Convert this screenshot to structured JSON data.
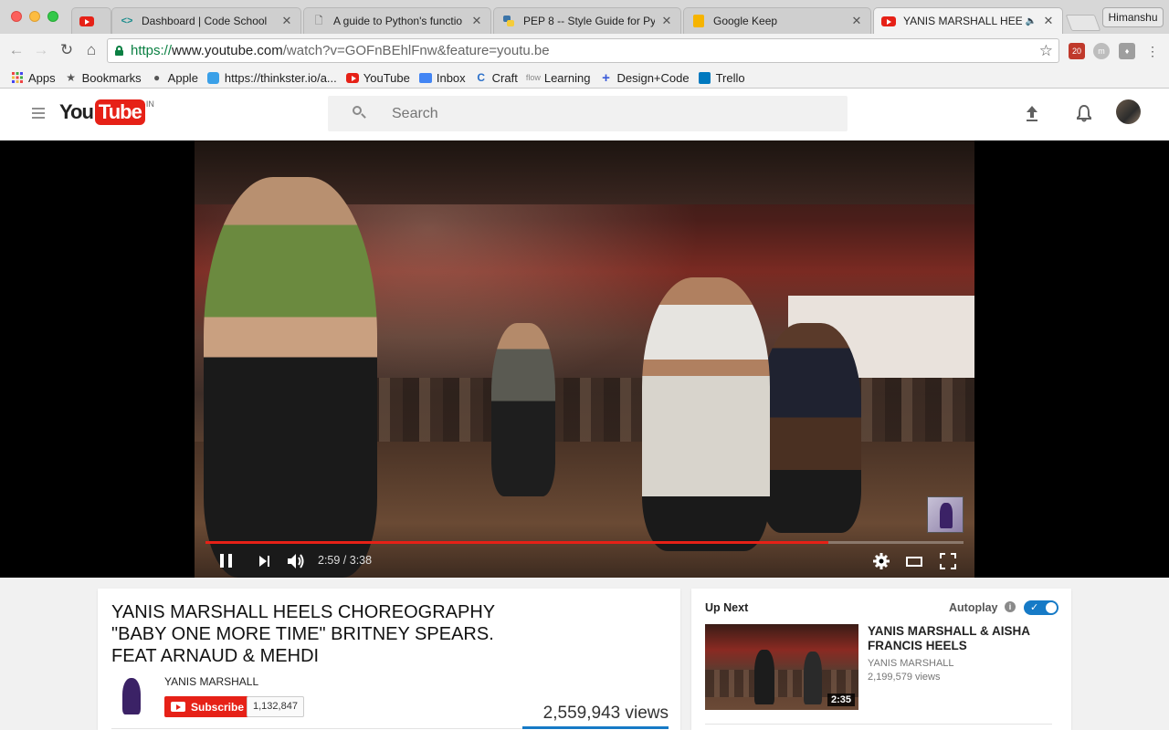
{
  "browser": {
    "tabs": [
      {
        "title": "",
        "favicon": "youtube-icon"
      },
      {
        "title": "Dashboard | Code School",
        "favicon": "code-school-icon"
      },
      {
        "title": "A guide to Python's functio",
        "favicon": "document-icon"
      },
      {
        "title": "PEP 8 -- Style Guide for Py",
        "favicon": "python-icon"
      },
      {
        "title": "Google Keep",
        "favicon": "keep-icon"
      },
      {
        "title": "YANIS MARSHALL HEEL",
        "favicon": "youtube-icon",
        "active": true,
        "audio": true
      }
    ],
    "profile_name": "Himanshu",
    "url": {
      "scheme": "https://",
      "host": "www.youtube.com",
      "path": "/watch?v=GOFnBEhlFnw&feature=youtu.be"
    },
    "extension_badge": "20",
    "bookmarks": [
      {
        "label": "Apps",
        "icon": "apps-grid-icon"
      },
      {
        "label": "Bookmarks",
        "icon": "star-icon"
      },
      {
        "label": "Apple",
        "icon": "apple-icon"
      },
      {
        "label": "https://thinkster.io/a...",
        "icon": "thinkster-icon"
      },
      {
        "label": "YouTube",
        "icon": "youtube-icon"
      },
      {
        "label": "Inbox",
        "icon": "inbox-icon"
      },
      {
        "label": "Craft",
        "icon": "craft-icon"
      },
      {
        "label": "Learning",
        "icon": "learning-icon"
      },
      {
        "label": "Design+Code",
        "icon": "plus-icon"
      },
      {
        "label": "Trello",
        "icon": "trello-icon"
      }
    ]
  },
  "youtube": {
    "logo_you": "You",
    "logo_tube": "Tube",
    "country": "IN",
    "search_placeholder": "Search",
    "accent": "#e62117"
  },
  "player": {
    "time_current": "2:59",
    "time_total": "3:38",
    "time_display": "2:59 / 3:38",
    "progress_fraction": 0.8211
  },
  "video": {
    "title": "YANIS MARSHALL HEELS CHOREOGRAPHY \"BABY ONE MORE TIME\" BRITNEY SPEARS. FEAT ARNAUD & MEHDI",
    "channel": "YANIS MARSHALL",
    "subscribe_label": "Subscribe",
    "subscriber_count": "1,132,847",
    "views": "2,559,943 views"
  },
  "sidebar": {
    "up_next_label": "Up Next",
    "autoplay_label": "Autoplay",
    "autoplay_on": true,
    "next_video": {
      "title": "YANIS MARSHALL & AISHA FRANCIS HEELS",
      "channel": "YANIS MARSHALL",
      "views": "2,199,579 views",
      "duration": "2:35"
    }
  }
}
